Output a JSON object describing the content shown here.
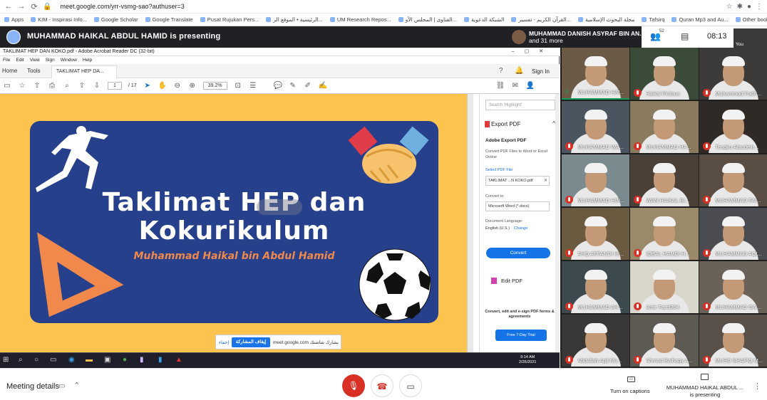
{
  "browser": {
    "url": "meet.google.com/yrr-vsmg-sao?authuser=3",
    "bookmarks": [
      "Apps",
      "KIM - Inspirasi Info...",
      "Google Scholar",
      "Google Translate",
      "Pusat Rujukan Pers...",
      "الرئيسية • الموقع الر...",
      "UM Research Repos...",
      "الفتاوى | المجلس الأو...",
      "الشبكة الدعوية",
      "القرآن الكريم - تفسير...",
      "مجلة البحوث الإسلامية",
      "Tafsirq",
      "Quran Mp3 and Au...",
      "Other bookmarks"
    ]
  },
  "meet": {
    "presenting_title": "MUHAMMAD HAIKAL ABDUL HAMID is presenting",
    "speaker_name": "MUHAMMAD DANISH ASYRAF BIN AN...",
    "speaker_more": "and 31 more",
    "people_count": "52",
    "clock": "08:13",
    "you_label": "You"
  },
  "acrobat": {
    "window_title": "TAKLIMAT HEP DAN KOKO.pdf - Adobe Acrobat Reader DC (32-bit)",
    "menu": [
      "File",
      "Edit",
      "View",
      "Sign",
      "Window",
      "Help"
    ],
    "tabs": [
      "Home",
      "Tools"
    ],
    "doc_tab": "TAKLIMAT HEP DA...",
    "sign_in": "Sign In",
    "page": "1",
    "page_count": "/ 17",
    "zoom": "39.2%",
    "slide": {
      "title_line1": "Taklimat HEP dan",
      "title_line2": "Kokurikulum",
      "subtitle": "Muhammad Haikal bin Abdul Hamid"
    },
    "panel": {
      "search_placeholder": "Search 'Highlight'",
      "export_head": "Export PDF",
      "adobe_export": "Adobe Export PDF",
      "convert_desc": "Convert PDF Files to Word or Excel Online",
      "select_label": "Select PDF File",
      "file_name": "TAKLIMAT ...N KOKO.pdf",
      "convert_to": "Convert to",
      "format": "Microsoft Word (*.docx)",
      "lang_label": "Document Language:",
      "lang_value": "English (U.S.)",
      "lang_change": "Change",
      "convert_btn": "Convert",
      "edit_pdf": "Edit PDF",
      "promo": "Convert, edit and e-sign PDF forms & agreements",
      "trial_btn": "Free 7-Day Trial"
    }
  },
  "share_banner": {
    "close": "إخفاء",
    "stop": "إيقاف المشاركة",
    "text": "meet.google.com يشارك شاشتك"
  },
  "taskbar": {
    "time": "9:14 AM",
    "date": "2/26/2021"
  },
  "participants": [
    {
      "name": "MUHAMMAD HAI...",
      "speaking": true
    },
    {
      "name": "Haikal Firdaus",
      "speaking": false
    },
    {
      "name": "Muhammad Fadh...",
      "speaking": false
    },
    {
      "name": "MUHAMMAD WA...",
      "speaking": false
    },
    {
      "name": "MUHAMMAD HA...",
      "speaking": false
    },
    {
      "name": "Tengku Alaudein...",
      "speaking": false
    },
    {
      "name": "MUHAMMAD HIN...",
      "speaking": false
    },
    {
      "name": "WAN HAIKAL BI...",
      "speaking": false
    },
    {
      "name": "MUHAMMAD FAI...",
      "speaking": false
    },
    {
      "name": "AHQ AFFANDI HI...",
      "speaking": false
    },
    {
      "name": "IQBAL HAMDI H...",
      "speaking": false
    },
    {
      "name": "MUHAMMAD AQI...",
      "speaking": false
    },
    {
      "name": "MUHAMMAD AH...",
      "speaking": false
    },
    {
      "name": "Amir Farid304",
      "speaking": false
    },
    {
      "name": "MUHAMMAD OA...",
      "speaking": false
    },
    {
      "name": "Abdullah Aqil Mo...",
      "speaking": false
    },
    {
      "name": "Ahmad Baihaqy A...",
      "speaking": false
    },
    {
      "name": "MUHD SHAFIQ M...",
      "speaking": false
    }
  ],
  "bottom": {
    "meeting_details": "Meeting details",
    "captions_label": "Turn on captions",
    "presenter_line1": "MUHAMMAD HAIKAL ABDUL ...",
    "presenter_line2": "is presenting",
    "cc_text": "CC"
  }
}
